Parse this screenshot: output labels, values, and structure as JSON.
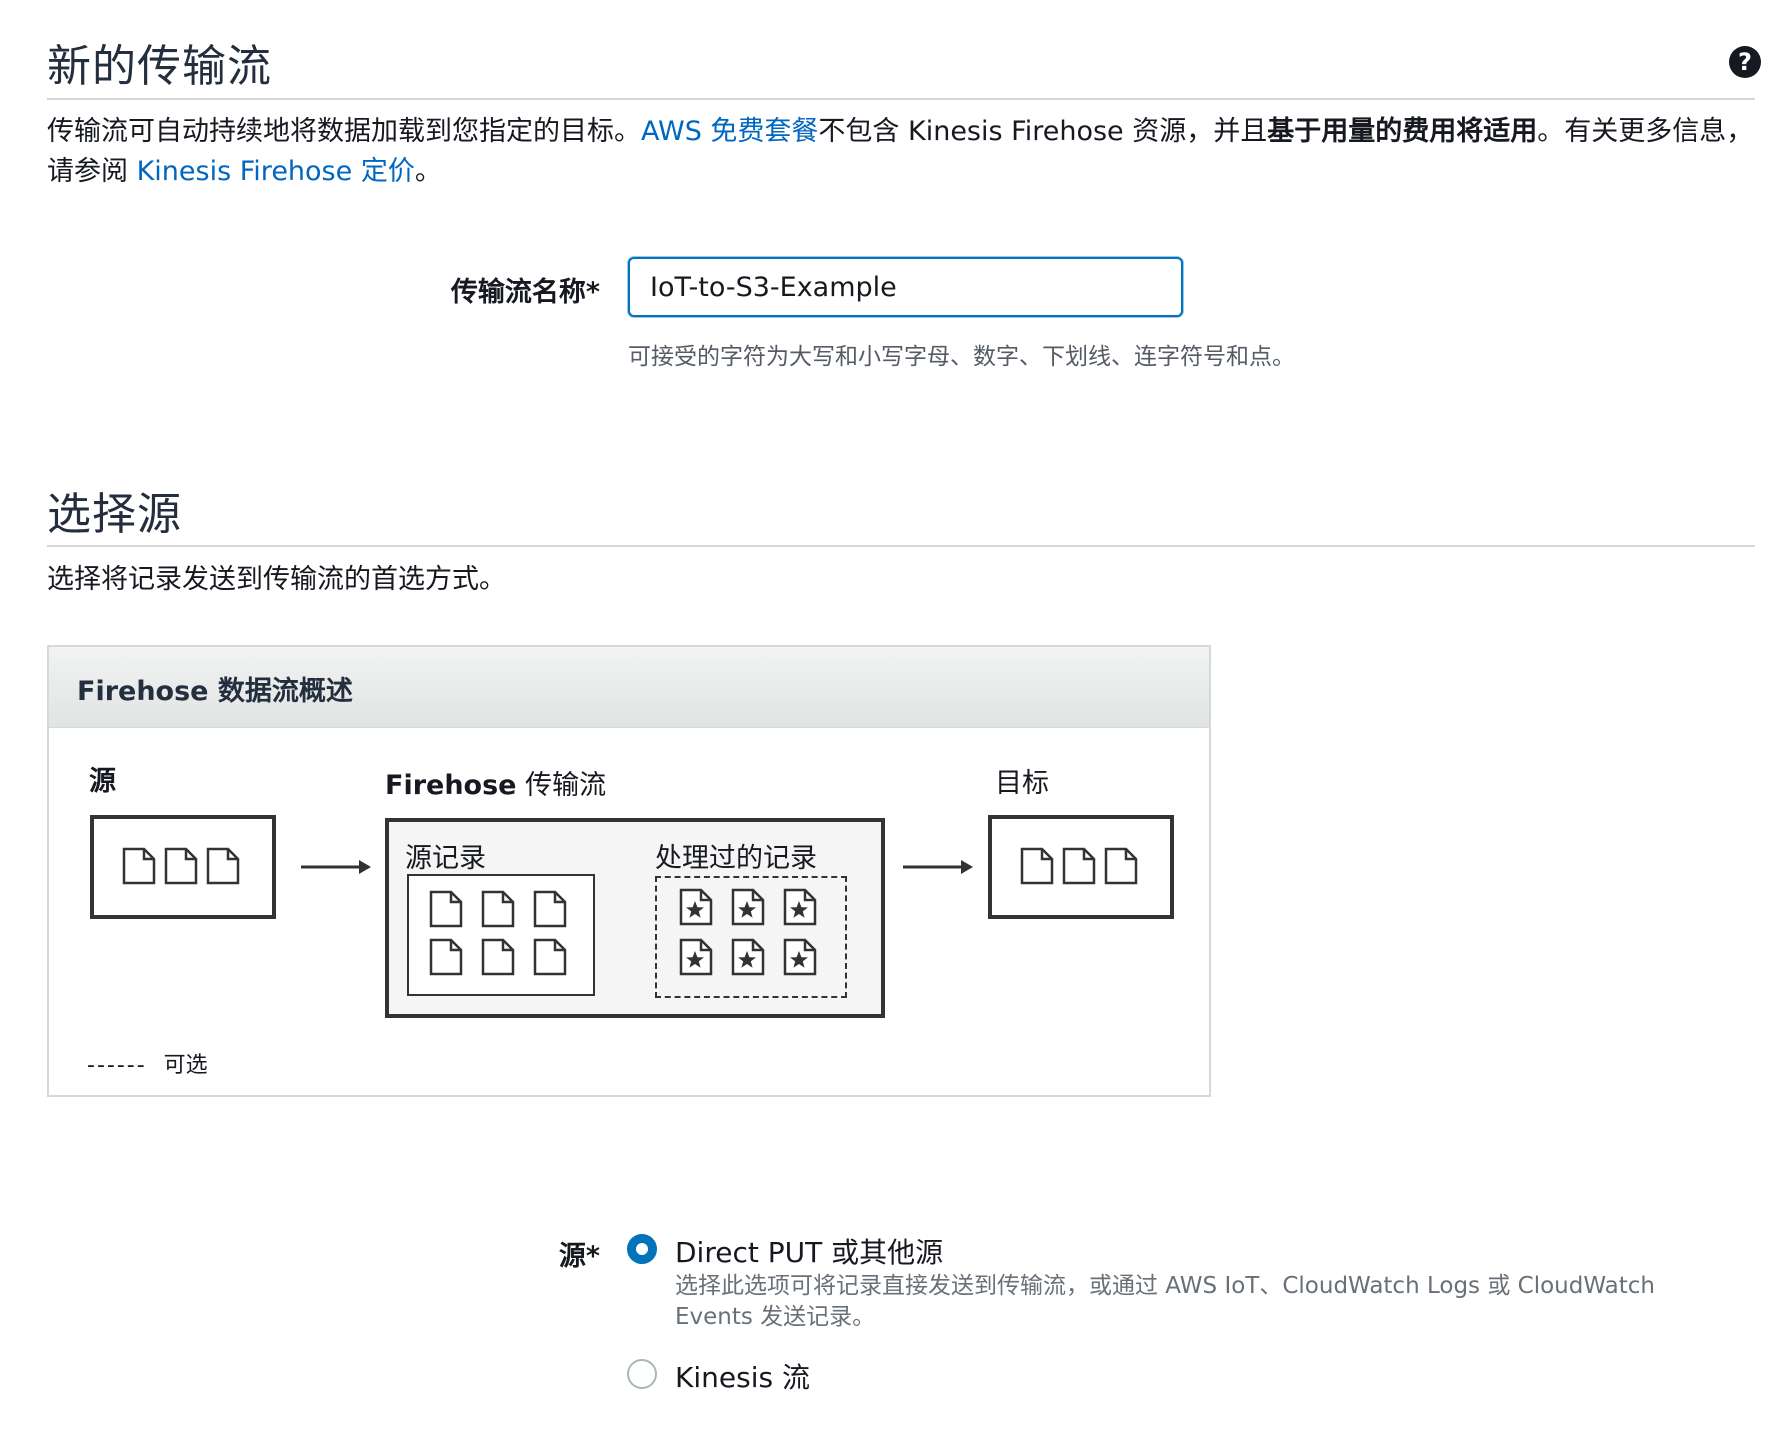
{
  "section1": {
    "title": "新的传输流",
    "help_icon": "question-circle-icon",
    "desc_part1": "传输流可自动持续地将数据加载到您指定的目标。",
    "desc_link1": "AWS 免费套餐",
    "desc_part2": "不包含 Kinesis Firehose 资源，并且",
    "desc_bold": "基于用量的费用将适用",
    "desc_part3": "。有关更多信息，请参阅 ",
    "desc_link2": "Kinesis Firehose 定价",
    "desc_part4": "。"
  },
  "name_field": {
    "label": "传输流名称*",
    "value": "IoT-to-S3-Example",
    "hint": "可接受的字符为大写和小写字母、数字、下划线、连字符号和点。"
  },
  "section2": {
    "title": "选择源",
    "desc": "选择将记录发送到传输流的首选方式。"
  },
  "overview": {
    "title": "Firehose 数据流概述",
    "source_label": "源",
    "stream_label_bold": "Firehose",
    "stream_label_rest": " 传输流",
    "target_label": "目标",
    "source_records_label": "源记录",
    "processed_records_label": "处理过的记录",
    "legend_dashes": "------",
    "legend_text": "可选",
    "doc_icon": "document-icon",
    "processed_doc_icon": "document-star-icon",
    "arrow_icon": "arrow-right-icon"
  },
  "source_select": {
    "label": "源*",
    "options": [
      {
        "label": "Direct PUT 或其他源",
        "desc": "选择此选项可将记录直接发送到传输流，或通过 AWS IoT、CloudWatch Logs 或 CloudWatch Events 发送记录。",
        "selected": true
      },
      {
        "label": "Kinesis 流",
        "desc": "",
        "selected": false
      }
    ]
  },
  "colors": {
    "link": "#0066c0",
    "radio_selected": "#0073bb",
    "focus_border": "#0073bb"
  }
}
